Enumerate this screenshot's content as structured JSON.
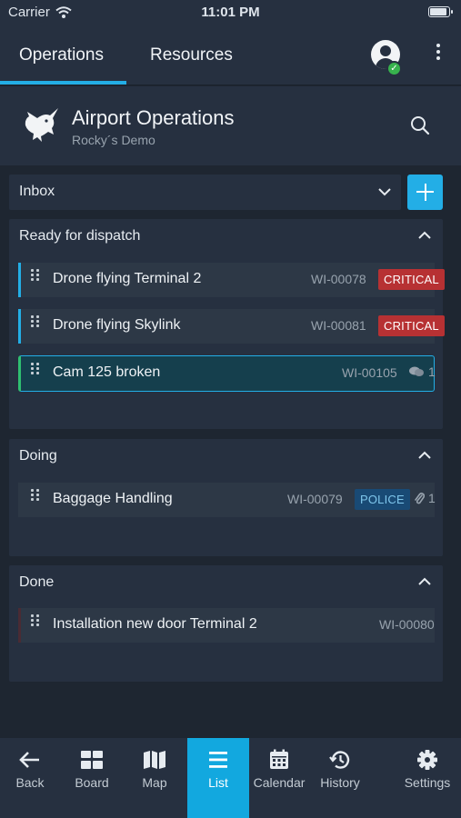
{
  "status_bar": {
    "carrier": "Carrier",
    "time": "11:01 PM"
  },
  "top_nav": {
    "tabs": [
      {
        "label": "Operations",
        "active": true
      },
      {
        "label": "Resources",
        "active": false
      }
    ]
  },
  "org": {
    "title": "Airport Operations",
    "subtitle": "Rocky´s Demo"
  },
  "inbox": {
    "label": "Inbox"
  },
  "sections": {
    "ready": {
      "title": "Ready for dispatch",
      "items": [
        {
          "title": "Drone flying Terminal 2",
          "id": "WI-00078",
          "badge": "CRITICAL"
        },
        {
          "title": "Drone flying Skylink",
          "id": "WI-00081",
          "badge": "CRITICAL"
        },
        {
          "title": "Cam 125 broken",
          "id": "WI-00105",
          "comments": "1"
        }
      ]
    },
    "doing": {
      "title": "Doing",
      "items": [
        {
          "title": "Baggage Handling",
          "id": "WI-00079",
          "badge": "POLICE",
          "attachments": "1"
        }
      ]
    },
    "done": {
      "title": "Done",
      "items": [
        {
          "title": "Installation new door Terminal 2",
          "id": "WI-00080"
        }
      ]
    }
  },
  "bottom_nav": {
    "items": [
      {
        "label": "Back",
        "icon": "arrow-left-icon"
      },
      {
        "label": "Board",
        "icon": "board-icon"
      },
      {
        "label": "Map",
        "icon": "map-icon"
      },
      {
        "label": "List",
        "icon": "list-icon",
        "active": true
      },
      {
        "label": "Calendar",
        "icon": "calendar-icon"
      },
      {
        "label": "History",
        "icon": "history-icon"
      },
      {
        "label": "Settings",
        "icon": "gear-icon"
      }
    ]
  },
  "colors": {
    "accent": "#23aee6",
    "critical": "#b73133",
    "police": "#194a75",
    "online": "#37b24d",
    "background": "#1e2631",
    "panel": "#263040"
  }
}
